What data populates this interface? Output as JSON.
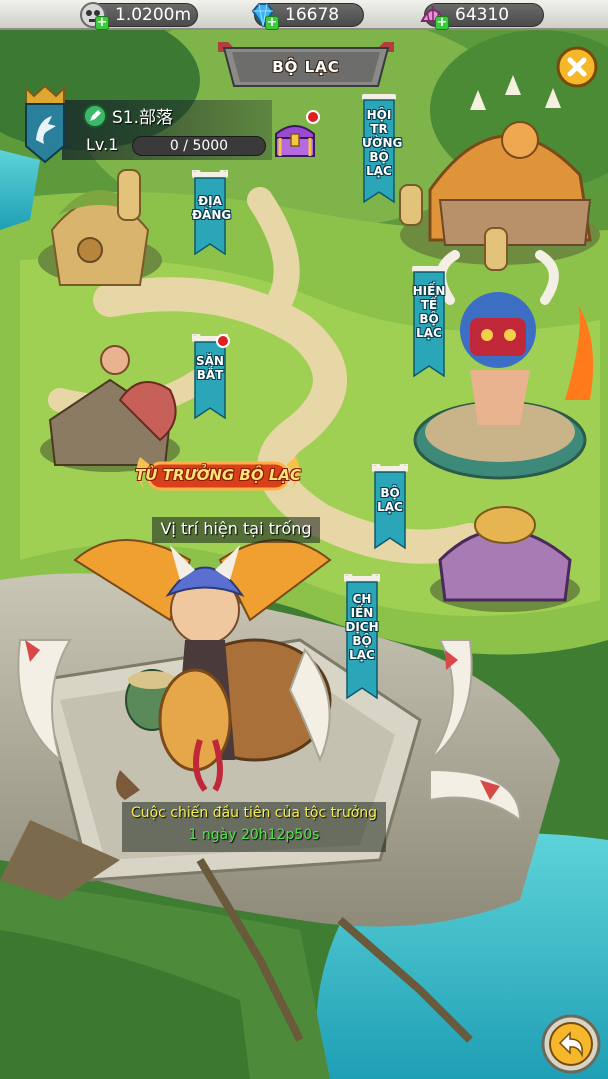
{
  "resources": [
    {
      "name": "power",
      "icon": "skull-coin-icon",
      "value": "1.0200m"
    },
    {
      "name": "gems",
      "icon": "blue-gem-icon",
      "value": "16678"
    },
    {
      "name": "shells",
      "icon": "shell-icon",
      "value": "64310"
    }
  ],
  "header": {
    "title": "BỘ LẠC"
  },
  "player": {
    "tribe_name": "S1.部落",
    "level_label": "Lv.1",
    "xp_text": "0 / 5000",
    "xp_progress": 0
  },
  "flags": {
    "hoi_truong": "HỘI TR ƯỜNG BỘ LẠC",
    "dia_dang": "ĐỊA ĐÀNG",
    "hien_te": "HIẾN TẾ BỘ LẠC",
    "san_bat": "SĂN BẮT",
    "bo_lac": "BỘ LẠC",
    "chien_dich": "CH IẾN DỊCH BỘ LẠC"
  },
  "chief": {
    "sign": "TÙ TRƯỞNG BỘ LẠC",
    "status": "Vị trí hiện tại trống"
  },
  "event": {
    "title": "Cuộc chiến đầu tiên của tộc trưởng",
    "countdown": "1 ngày 20h12p50s"
  },
  "colors": {
    "flag": "#2aa6b8",
    "accent_gold": "#f5b82a",
    "xp_fill": "#7ed957",
    "notification": "#e02020"
  }
}
